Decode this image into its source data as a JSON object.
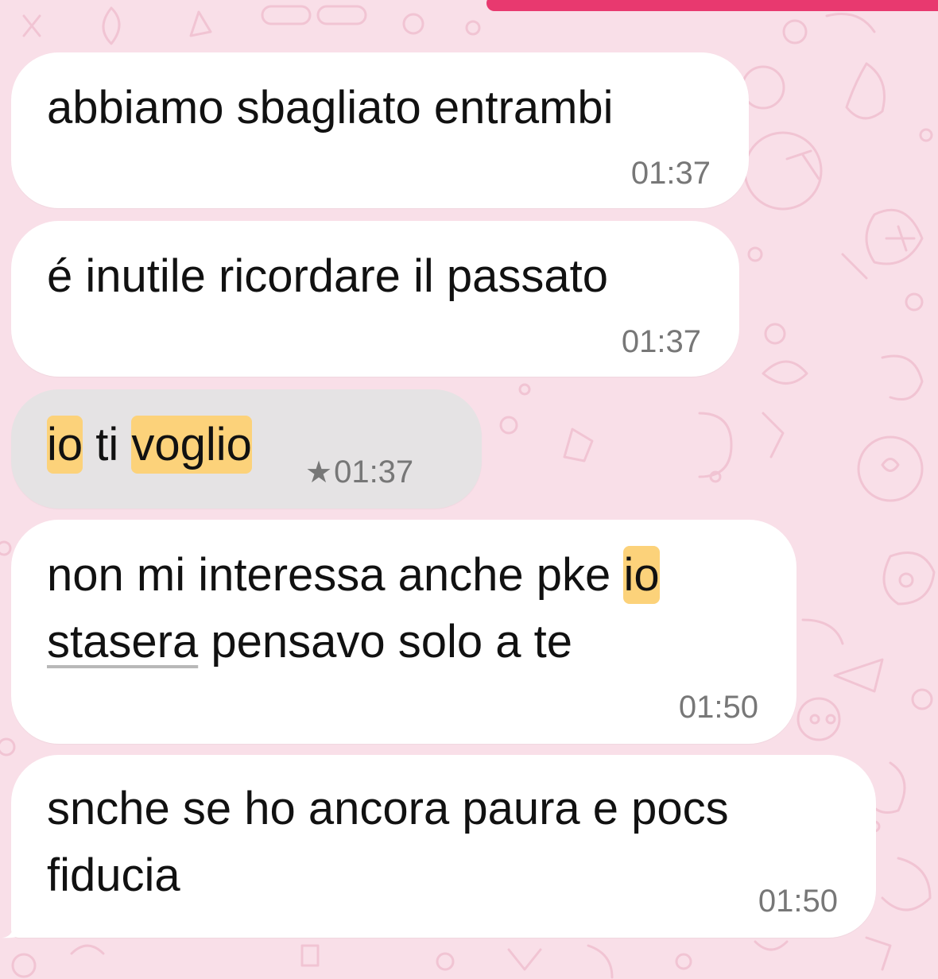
{
  "chat": {
    "messages": [
      {
        "text": "abbiamo sbagliato entrambi",
        "time": "01:37"
      },
      {
        "text": "é inutile ricordare il passato",
        "time": "01:37"
      },
      {
        "segments": [
          "io",
          " ti ",
          "voglio"
        ],
        "time": "01:37",
        "starred": true,
        "star_icon": "★"
      },
      {
        "line1_pre": "non mi interessa anche pke ",
        "line1_hl": "io",
        "line2_ul": "stasera",
        "line2_post": " pensavo solo a te",
        "time": "01:50"
      },
      {
        "line1": "snche se ho ancora paura e pocs",
        "line2": "fiducia",
        "time": "01:50"
      }
    ]
  },
  "colors": {
    "background": "#f9dfe8",
    "bubble": "#ffffff",
    "selected_bubble": "#e5e3e4",
    "highlight": "#fcd27a",
    "accent": "#e8396f"
  }
}
